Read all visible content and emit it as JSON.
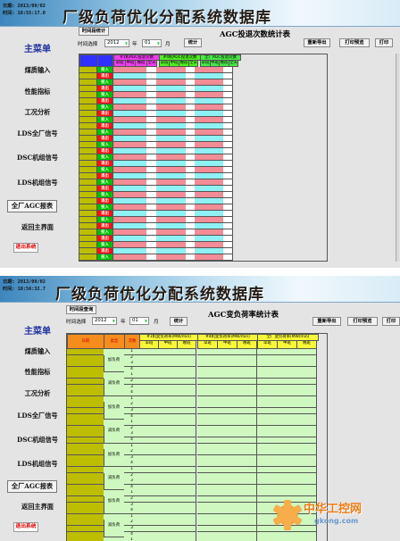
{
  "screen1": {
    "header": {
      "date_line": "日期: 2013/09/02",
      "time_line": "时间: 18:55:17.0",
      "title": "厂级负荷优化分配系统数据库"
    },
    "sidebar": {
      "menu_title": "主菜单",
      "items": [
        "煤质输入",
        "性能指标",
        "工况分析",
        "LDS全厂信号",
        "DSC机组信号",
        "LDS机组信号",
        "全厂AGC报表",
        "返回主界面"
      ],
      "exit_label": "退出系统"
    },
    "toolbar": {
      "period_button": "时间段统计",
      "time_select_label": "时间选择",
      "year_value": "2012",
      "year_unit": "年",
      "month_value": "01",
      "month_unit": "月",
      "stat_button": "统计"
    },
    "report_title": "AGC投退次数统计表",
    "actions": [
      "重新导出",
      "打印预览",
      "打印"
    ],
    "table": {
      "groups": [
        "#1机AGC投退次数",
        "#4机AGC投退次数",
        "全厂AGC投退次数"
      ],
      "subcols": [
        "早班",
        "中班",
        "晚班",
        "全天"
      ],
      "row_labels": [
        "投入",
        "退出"
      ]
    }
  },
  "screen2": {
    "header": {
      "date_line": "日期: 2013/09/02",
      "time_line": "时间: 18:56:32.7",
      "title": "厂级负荷优化分配系统数据库"
    },
    "sidebar": {
      "menu_title": "主菜单",
      "items": [
        "煤质输入",
        "性能指标",
        "工况分析",
        "LDS全厂信号",
        "DSC机组信号",
        "LDS机组信号",
        "全厂AGC报表",
        "返回主界面"
      ],
      "exit_label": "退出系统"
    },
    "toolbar": {
      "period_button": "时间段查询",
      "time_select_label": "时间选择",
      "year_value": "2012",
      "year_unit": "年",
      "month_value": "01",
      "month_unit": "月",
      "stat_button": "统计"
    },
    "report_title": "AGC变负荷率统计表",
    "actions": [
      "重新导出",
      "打印预览",
      "打印"
    ],
    "table": {
      "headers": [
        "日期",
        "类型",
        "次数"
      ],
      "groups": [
        "#1机变负荷率(MW/min)",
        "#4机变负荷率(MW/min)",
        "全厂变负荷率(MW/min)"
      ],
      "group_subcols": [
        [
          "早班",
          "中班",
          "晚班"
        ],
        [
          "早班",
          "中班",
          "晚班"
        ],
        [
          "早班",
          "中班",
          "晚班"
        ]
      ],
      "types": [
        "加负荷",
        "减负荷"
      ],
      "counts": [
        "1",
        "2",
        "3",
        "4"
      ]
    }
  },
  "watermark": {
    "site_name": "中华工控网",
    "url": "gkong.com"
  },
  "colors": {
    "pink": "#f28c96",
    "cyan": "#8ef1f3",
    "olive": "#bebe00",
    "green_cell": "#00c000",
    "red_cell": "#ff1010",
    "light_green": "#cef8c0",
    "orange_header": "#f58d1c"
  }
}
